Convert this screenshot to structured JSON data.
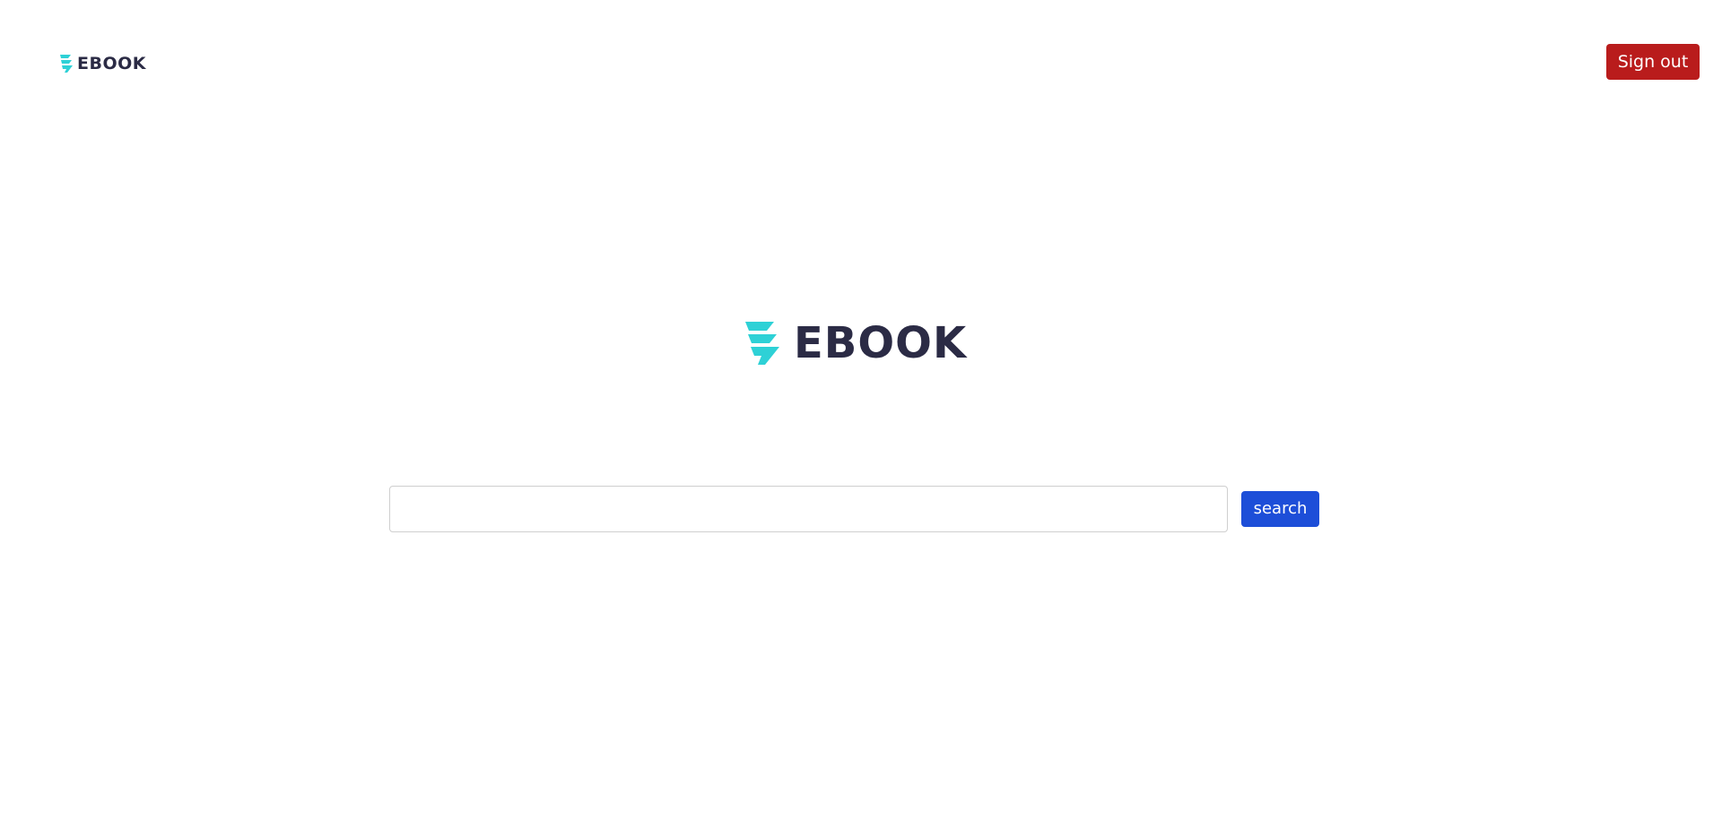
{
  "header": {
    "logo": {
      "icon": "ebook-logo-icon",
      "text": "EBOOK",
      "icon_color": "#2ed1d6",
      "text_color": "#2b2b45"
    },
    "signout_label": "Sign out",
    "signout_color": "#b91c1c"
  },
  "main": {
    "logo": {
      "icon": "ebook-logo-icon",
      "text": "EBOOK"
    },
    "search": {
      "value": "",
      "placeholder": "",
      "button_label": "search",
      "button_color": "#1d4ed8"
    }
  }
}
